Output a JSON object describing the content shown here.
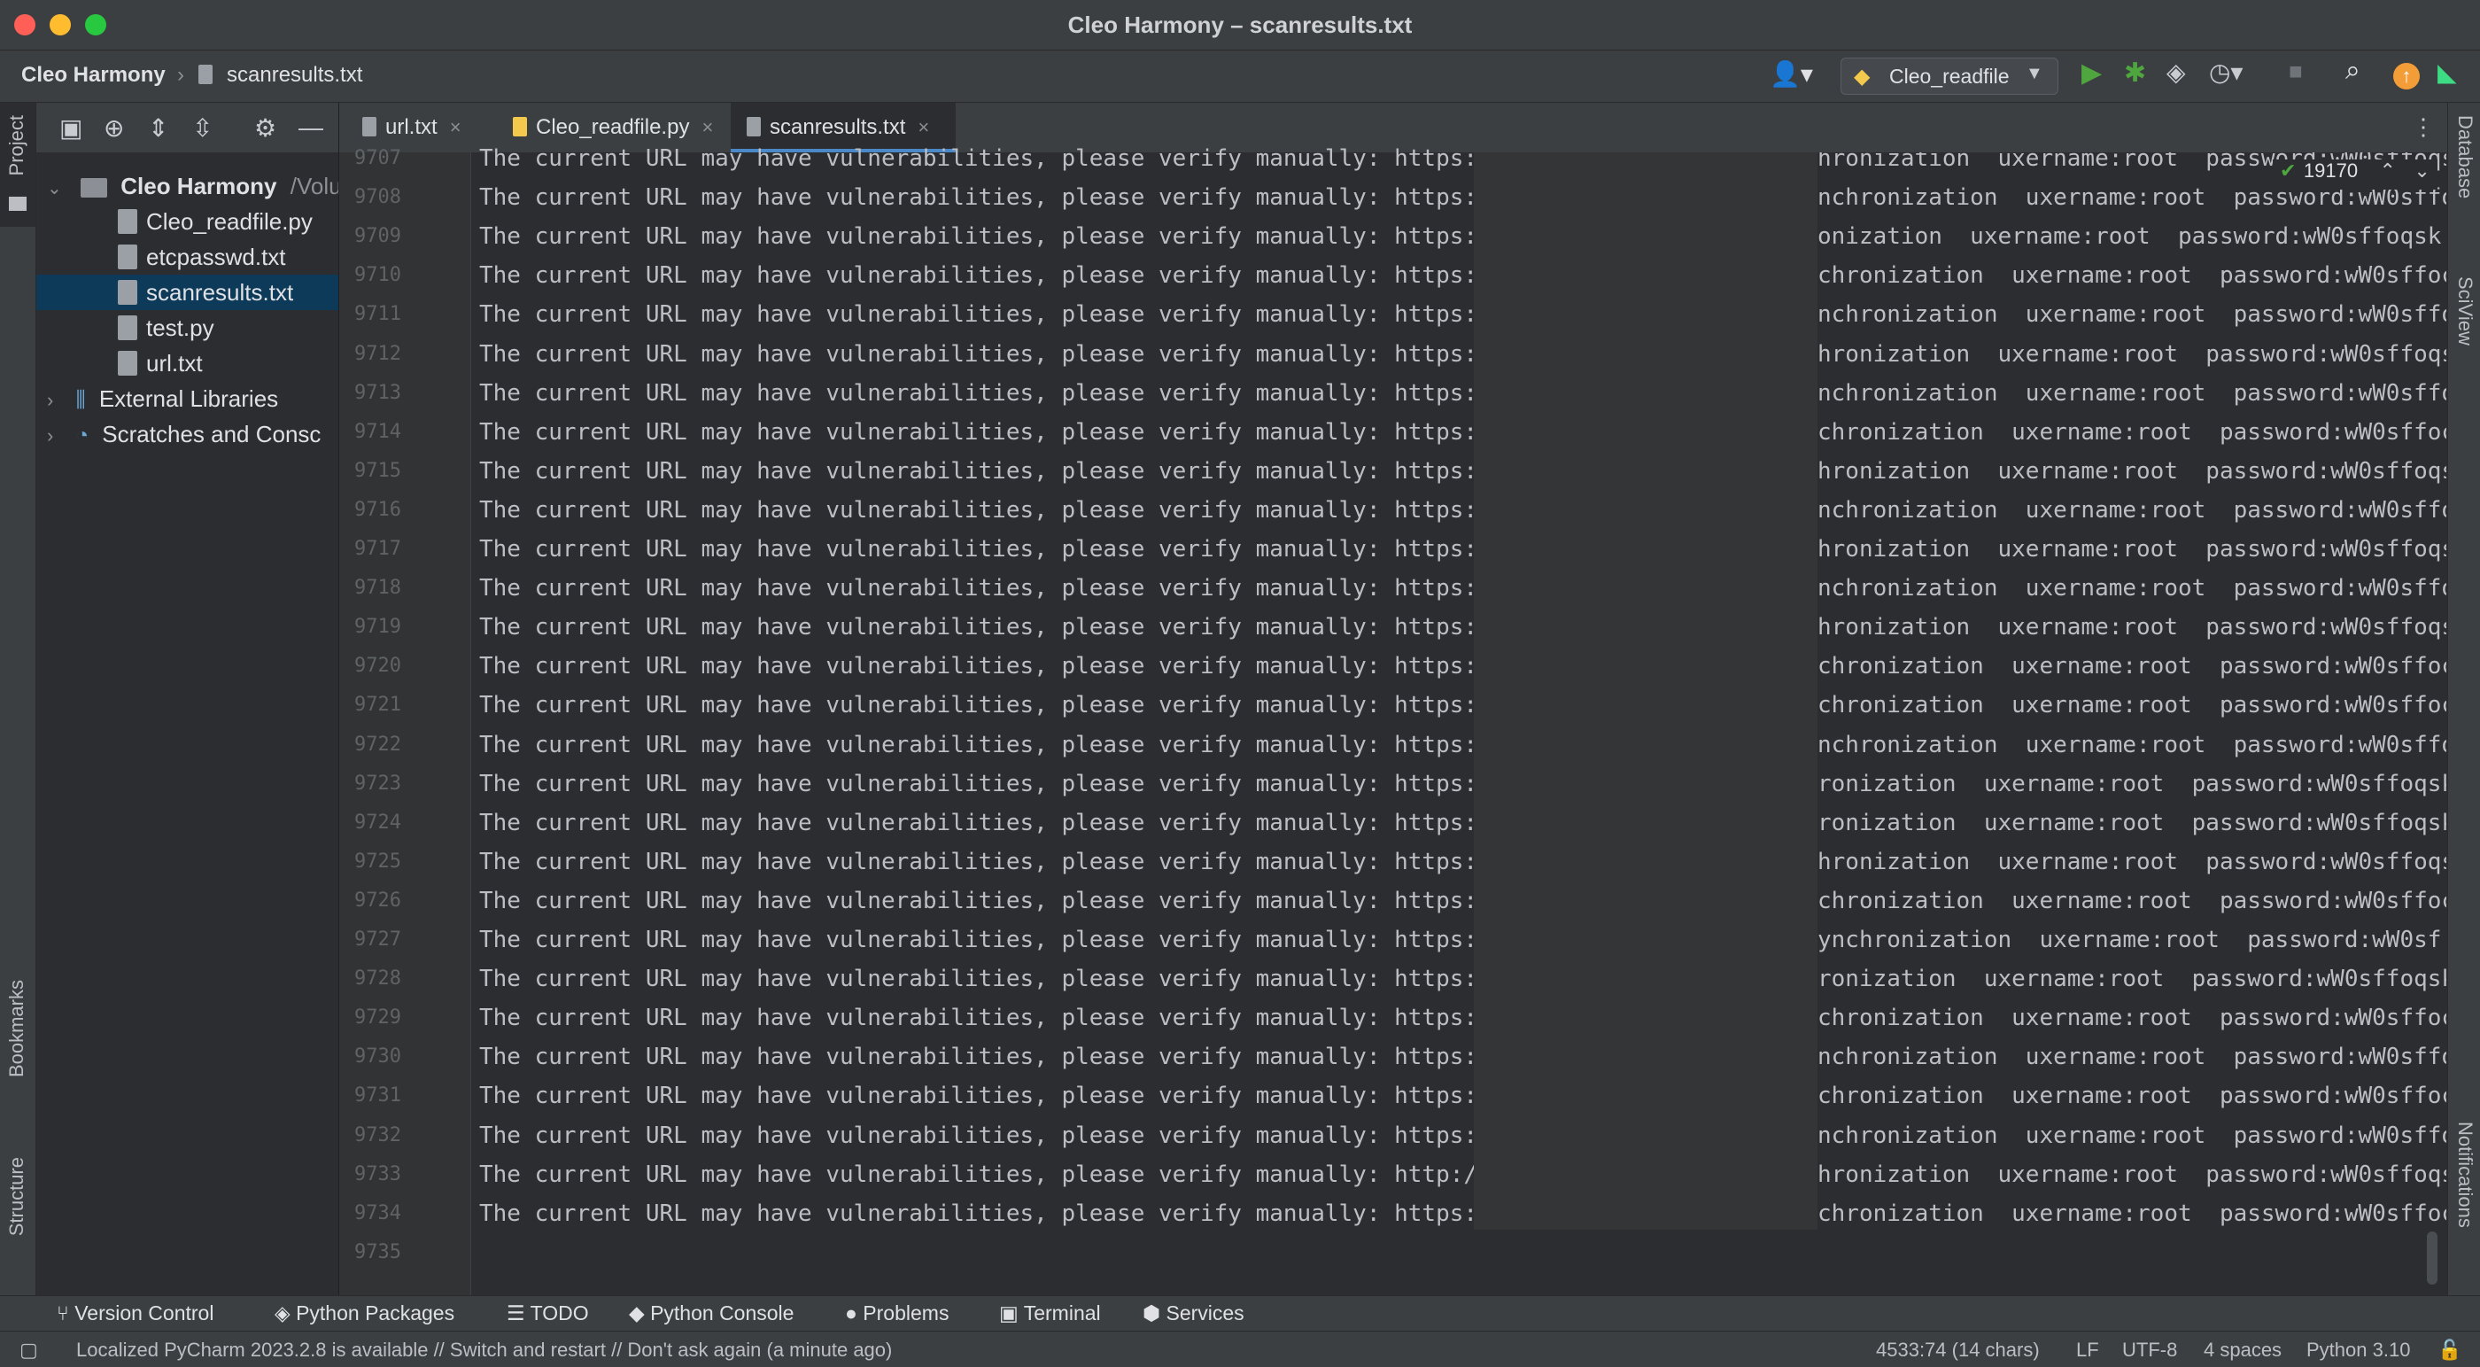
{
  "window": {
    "title": "Cleo Harmony – scanresults.txt"
  },
  "navbar": {
    "project": "Cleo Harmony",
    "file": "scanresults.txt",
    "run_config": "Cleo_readfile"
  },
  "left_strip": {
    "project": "Project",
    "bookmarks": "Bookmarks",
    "structure": "Structure"
  },
  "right_strip": {
    "database": "Database",
    "sciview": "SciView",
    "notifications": "Notifications"
  },
  "project_tree": {
    "root": "Cleo Harmony",
    "root_path": "/Volu",
    "files": [
      "Cleo_readfile.py",
      "etcpasswd.txt",
      "scanresults.txt",
      "test.py",
      "url.txt"
    ],
    "external": "External Libraries",
    "scratches": "Scratches and Consc"
  },
  "tabs": [
    "url.txt",
    "Cleo_readfile.py",
    "scanresults.txt"
  ],
  "tab_close": "×",
  "search": {
    "count": "19170"
  },
  "editor": {
    "prefix": "The current URL may have vulnerabilities, please verify manually:",
    "lines": [
      {
        "n": "9707",
        "proto": "https:",
        "tail": "hronization  uxername:root  password:wW0sffoqs"
      },
      {
        "n": "9708",
        "proto": "https:",
        "tail": "nchronization  uxername:root  password:wW0sffo"
      },
      {
        "n": "9709",
        "proto": "https:",
        "tail": "onization  uxername:root  password:wW0sffoqsk"
      },
      {
        "n": "9710",
        "proto": "https:",
        "tail": "chronization  uxername:root  password:wW0sffoc"
      },
      {
        "n": "9711",
        "proto": "https:",
        "tail": "nchronization  uxername:root  password:wW0sffo"
      },
      {
        "n": "9712",
        "proto": "https:",
        "tail": "hronization  uxername:root  password:wW0sffoqs"
      },
      {
        "n": "9713",
        "proto": "https:",
        "tail": "nchronization  uxername:root  password:wW0sffo"
      },
      {
        "n": "9714",
        "proto": "https:",
        "tail": "chronization  uxername:root  password:wW0sffoc"
      },
      {
        "n": "9715",
        "proto": "https:",
        "tail": "hronization  uxername:root  password:wW0sffoqs"
      },
      {
        "n": "9716",
        "proto": "https:",
        "tail": "nchronization  uxername:root  password:wW0sffo"
      },
      {
        "n": "9717",
        "proto": "https:",
        "tail": "hronization  uxername:root  password:wW0sffoqs"
      },
      {
        "n": "9718",
        "proto": "https:",
        "tail": "nchronization  uxername:root  password:wW0sffo"
      },
      {
        "n": "9719",
        "proto": "https:",
        "tail": "hronization  uxername:root  password:wW0sffoqs"
      },
      {
        "n": "9720",
        "proto": "https:",
        "tail": "chronization  uxername:root  password:wW0sffoc"
      },
      {
        "n": "9721",
        "proto": "https:",
        "tail": "chronization  uxername:root  password:wW0sffoc"
      },
      {
        "n": "9722",
        "proto": "https:",
        "tail": "nchronization  uxername:root  password:wW0sffo"
      },
      {
        "n": "9723",
        "proto": "https:",
        "tail": "ronization  uxername:root  password:wW0sffoqsk"
      },
      {
        "n": "9724",
        "proto": "https:",
        "tail": "ronization  uxername:root  password:wW0sffoqsk"
      },
      {
        "n": "9725",
        "proto": "https:",
        "tail": "hronization  uxername:root  password:wW0sffoqs"
      },
      {
        "n": "9726",
        "proto": "https:",
        "tail": "chronization  uxername:root  password:wW0sffoc"
      },
      {
        "n": "9727",
        "proto": "https:",
        "tail": "ynchronization  uxername:root  password:wW0sf"
      },
      {
        "n": "9728",
        "proto": "https:",
        "tail": "ronization  uxername:root  password:wW0sffoqsk"
      },
      {
        "n": "9729",
        "proto": "https:",
        "tail": "chronization  uxername:root  password:wW0sffoc"
      },
      {
        "n": "9730",
        "proto": "https:",
        "tail": "nchronization  uxername:root  password:wW0sffo"
      },
      {
        "n": "9731",
        "proto": "https:",
        "tail": "chronization  uxername:root  password:wW0sffoc"
      },
      {
        "n": "9732",
        "proto": "https:",
        "tail": "nchronization  uxername:root  password:wW0sffo"
      },
      {
        "n": "9733",
        "proto": "http:/",
        "tail": "hronization  uxername:root  password:wW0sffoqs"
      },
      {
        "n": "9734",
        "proto": "https:",
        "tail": "chronization  uxername:root  password:wW0sffoc"
      },
      {
        "n": "9735",
        "proto": "",
        "tail": ""
      }
    ]
  },
  "bottom_tools": [
    "Version Control",
    "Python Packages",
    "TODO",
    "Python Console",
    "Problems",
    "Terminal",
    "Services"
  ],
  "status": {
    "message": "Localized PyCharm 2023.2.8 is available // Switch and restart // Don't ask again (a minute ago)",
    "position": "4533:74 (14 chars)",
    "line_sep": "LF",
    "encoding": "UTF-8",
    "indent": "4 spaces",
    "interpreter": "Python 3.10"
  },
  "colors": {
    "accent": "#4a88c7",
    "run_green": "#4fa63f",
    "selection": "#0d3a58"
  },
  "icons": [
    "apple-close-dot",
    "apple-minimize-dot",
    "apple-maximize-dot",
    "run-icon",
    "debug-icon",
    "search-icon",
    "update-icon"
  ]
}
